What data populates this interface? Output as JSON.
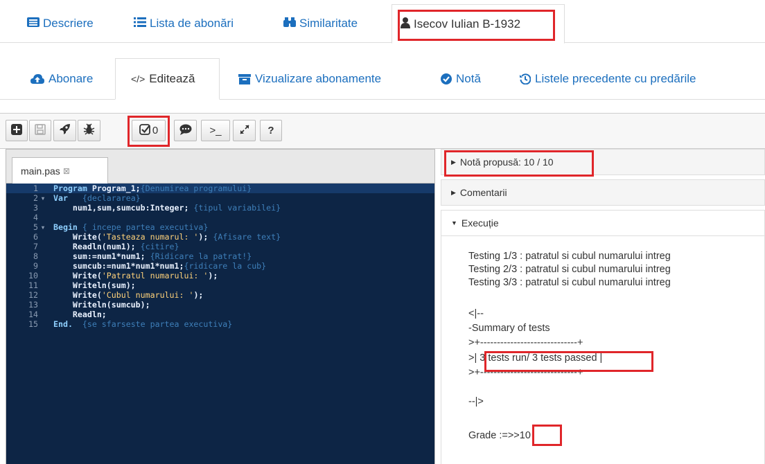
{
  "top_tabs": [
    {
      "label": "Descriere",
      "icon": "list-alt-icon"
    },
    {
      "label": "Lista de abonări",
      "icon": "list-icon"
    },
    {
      "label": "Similaritate",
      "icon": "binoculars-icon"
    },
    {
      "label": "Isecov Iulian B-1932",
      "icon": "user-icon"
    }
  ],
  "sub_tabs": [
    {
      "label": "Abonare",
      "icon": "cloud-upload-icon"
    },
    {
      "label": "Editează",
      "icon": "code-icon"
    },
    {
      "label": "Vizualizare abonamente",
      "icon": "archive-icon"
    },
    {
      "label": "Notă",
      "icon": "check-circle-icon"
    },
    {
      "label": "Listele precedente cu predările",
      "icon": "history-icon"
    }
  ],
  "toolbar": {
    "run_tests_count": "0",
    "help_label": "?",
    "console_label": ">_"
  },
  "editor": {
    "file_tab": "main.pas",
    "lines": [
      {
        "n": "1",
        "fold": "",
        "parts": [
          {
            "t": "Program",
            "c": "kw"
          },
          {
            "t": " Program_1;",
            "c": "pl"
          },
          {
            "t": "{Denumirea programului}",
            "c": "cm"
          }
        ]
      },
      {
        "n": "2",
        "fold": "▾",
        "parts": [
          {
            "t": "Var",
            "c": "kw"
          },
          {
            "t": "   ",
            "c": "pl"
          },
          {
            "t": "{declararea}",
            "c": "cm"
          }
        ]
      },
      {
        "n": "3",
        "fold": "",
        "parts": [
          {
            "t": "    num1,sum,sumcub:Integer; ",
            "c": "pl"
          },
          {
            "t": "{tipul variabilei}",
            "c": "cm"
          }
        ]
      },
      {
        "n": "4",
        "fold": "",
        "parts": []
      },
      {
        "n": "5",
        "fold": "▾",
        "parts": [
          {
            "t": "Begin",
            "c": "kw"
          },
          {
            "t": " ",
            "c": "pl"
          },
          {
            "t": "{ incepe partea executiva}",
            "c": "cm"
          }
        ]
      },
      {
        "n": "6",
        "fold": "",
        "parts": [
          {
            "t": "    Write(",
            "c": "pl"
          },
          {
            "t": "'Tasteaza numarul: '",
            "c": "st"
          },
          {
            "t": "); ",
            "c": "pl"
          },
          {
            "t": "{Afisare text}",
            "c": "cm"
          }
        ]
      },
      {
        "n": "7",
        "fold": "",
        "parts": [
          {
            "t": "    Readln(num1); ",
            "c": "pl"
          },
          {
            "t": "{citire}",
            "c": "cm"
          }
        ]
      },
      {
        "n": "8",
        "fold": "",
        "parts": [
          {
            "t": "    sum:=num1*num1; ",
            "c": "pl"
          },
          {
            "t": "{Ridicare la patrat!}",
            "c": "cm"
          }
        ]
      },
      {
        "n": "9",
        "fold": "",
        "parts": [
          {
            "t": "    sumcub:=num1*num1*num1;",
            "c": "pl"
          },
          {
            "t": "{ridicare la cub}",
            "c": "cm"
          }
        ]
      },
      {
        "n": "10",
        "fold": "",
        "parts": [
          {
            "t": "    Write(",
            "c": "pl"
          },
          {
            "t": "'Patratul numarului: '",
            "c": "st"
          },
          {
            "t": ");",
            "c": "pl"
          }
        ]
      },
      {
        "n": "11",
        "fold": "",
        "parts": [
          {
            "t": "    Writeln(sum);",
            "c": "pl"
          }
        ]
      },
      {
        "n": "12",
        "fold": "",
        "parts": [
          {
            "t": "    Write(",
            "c": "pl"
          },
          {
            "t": "'Cubul numarului: '",
            "c": "st"
          },
          {
            "t": ");",
            "c": "pl"
          }
        ]
      },
      {
        "n": "13",
        "fold": "",
        "parts": [
          {
            "t": "    Writeln(sumcub);",
            "c": "pl"
          }
        ]
      },
      {
        "n": "14",
        "fold": "",
        "parts": [
          {
            "t": "    Readln;",
            "c": "pl"
          }
        ]
      },
      {
        "n": "15",
        "fold": "",
        "parts": [
          {
            "t": "End.",
            "c": "kw"
          },
          {
            "t": "  ",
            "c": "pl"
          },
          {
            "t": "{se sfarseste partea executiva}",
            "c": "cm"
          }
        ]
      }
    ]
  },
  "right_panel": {
    "grade_header": "Notă propusă: 10 / 10",
    "comments_header": "Comentarii",
    "execution_header": "Execuție",
    "output_lines": [
      "Testing 1/3 : patratul si cubul numarului intreg",
      "Testing 2/3 : patratul si cubul numarului intreg",
      "Testing 3/3 : patratul si cubul numarului intreg",
      "<|--",
      "-Summary of tests",
      ">+-----------------------------+",
      ">| 3 tests run/ 3 tests passed |",
      ">+-----------------------------+",
      "--|>",
      "Grade :=>>10"
    ]
  },
  "colors": {
    "link": "#1c6fbe",
    "highlight_border": "#e0262a",
    "editor_bg": "#0d2545"
  }
}
